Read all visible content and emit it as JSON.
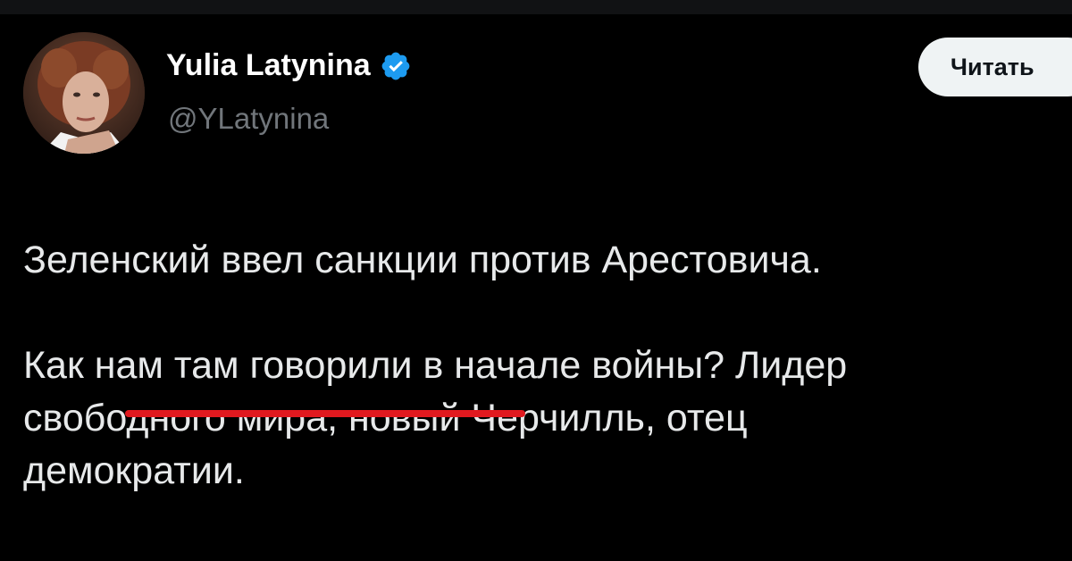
{
  "author": {
    "display_name": "Yulia Latynina",
    "handle": "@YLatynina",
    "verified": true,
    "verified_color": "#1d9bf0",
    "avatar_icon": "profile-photo"
  },
  "follow_button": {
    "label": "Читать"
  },
  "tweet": {
    "paragraph1": "Зеленский ввел санкции против Арестовича.",
    "paragraph2_line1": "Как нам там говорили в начале войны? Лидер",
    "paragraph2_line2": "свободного мира, новый Черчилль, отец",
    "paragraph2_line3": "демократии."
  },
  "annotation": {
    "underline_color": "#e0191f"
  }
}
